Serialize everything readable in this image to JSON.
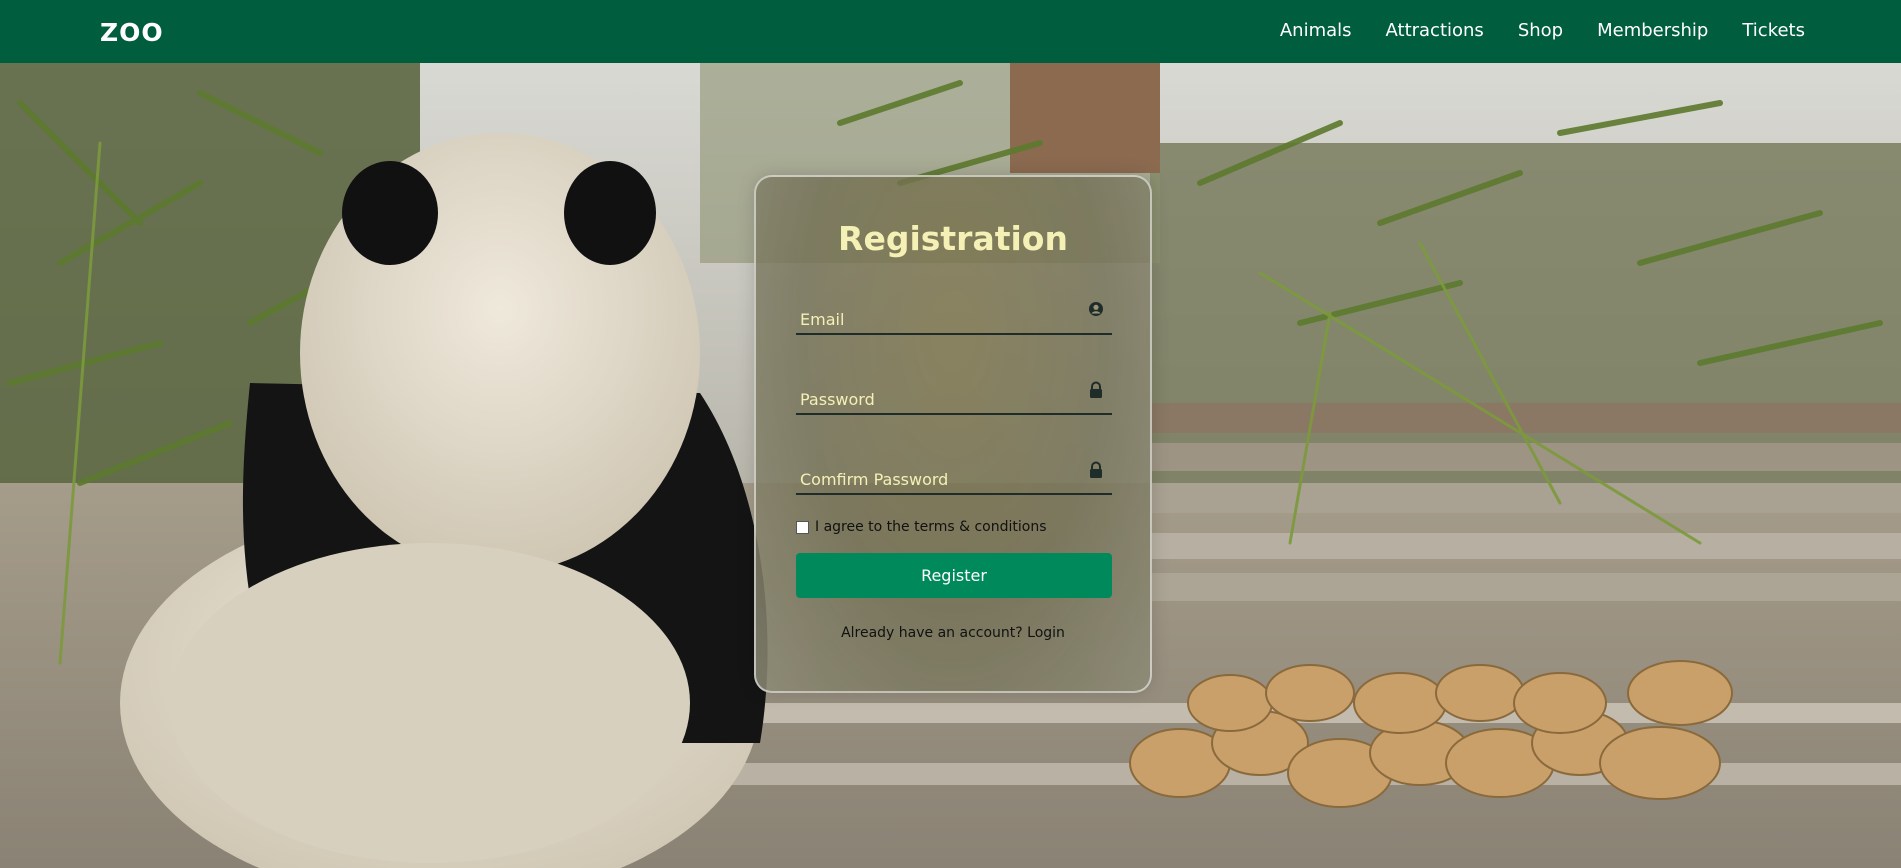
{
  "navbar": {
    "logo": "ZOO",
    "links": [
      "Animals",
      "Attractions",
      "Shop",
      "Membership",
      "Tickets"
    ],
    "background_color": "#005e3f"
  },
  "registration": {
    "title": "Registration",
    "email_placeholder": "Email",
    "password_placeholder": "Password",
    "confirm_placeholder": "Comfirm Password",
    "email_icon": "user-circle-icon",
    "password_icon": "lock-icon",
    "confirm_icon": "lock-icon",
    "terms_label": "I agree to the terms & conditions",
    "register_label": "Register",
    "login_prompt": "Already have an account?",
    "login_link": "Login",
    "accent_color": "#008a5c",
    "title_color": "#f5f0b5"
  },
  "background": {
    "scene": "panda-eating-bamboo-photo"
  }
}
